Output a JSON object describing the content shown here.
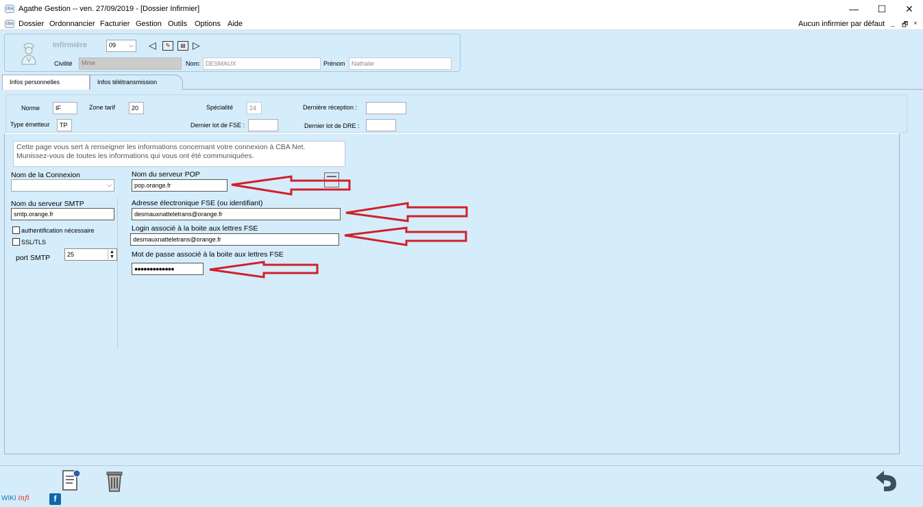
{
  "window": {
    "app_icon_label": "cba",
    "title": "Agathe Gestion   --   ven. 27/09/2019  - [Dossier Infirmier]",
    "minimize_glyph": "—",
    "maximize_glyph": "☐",
    "close_glyph": "✕"
  },
  "menu": {
    "items": [
      {
        "label": "Dossier"
      },
      {
        "label": "Ordonnancier"
      },
      {
        "label": "Facturier"
      },
      {
        "label": "Gestion"
      },
      {
        "label": "Outils"
      },
      {
        "label": "Options"
      },
      {
        "label": "Aide"
      }
    ],
    "right_status": "Aucun infirmier par défaut",
    "mdi_min": "_",
    "mdi_restore": "🗗",
    "mdi_close": "×"
  },
  "header": {
    "infirmiere_label": "Infirmière",
    "selector_value": "09",
    "prev_glyph": "◁",
    "next_glyph": "▷",
    "civilite_label": "Civilité",
    "civilite_value": "Mme",
    "nom_label": "Nom:",
    "nom_value": "DESMAUX",
    "prenom_label": "Prénom",
    "prenom_value": "Nathalie"
  },
  "tabs": [
    {
      "label": "Infos personnelles",
      "active": false
    },
    {
      "label": "Infos télétransmission",
      "active": true
    }
  ],
  "info": {
    "norme_label": "Norme",
    "norme_value": "IF",
    "zone_label": "Zone tarif",
    "zone_value": "20",
    "specialite_label": "Spécialité",
    "specialite_value": "24",
    "derniere_reception_label": "Dernière réception :",
    "derniere_reception_value": "",
    "type_emetteur_label": "Type émetteur",
    "type_emetteur_value": "TP",
    "dernier_fse_label": "Dernier lot de FSE :",
    "dernier_fse_value": "",
    "dernier_dre_label": "Dernier lot de DRE :",
    "dernier_dre_value": ""
  },
  "content": {
    "note_line1": "Cette page vous sert à renseigner les informations concernant votre connexion à CBA Net.",
    "note_line2": "Munissez-vous de toutes les informations qui vous ont été communiquées.",
    "connexion_label": "Nom de la Connexion",
    "connexion_value": "",
    "pop_label": "Nom du serveur POP",
    "pop_value": "pop.orange.fr",
    "smtp_label": "Nom du serveur SMTP",
    "smtp_value": "smtp.orange.fr",
    "email_label": "Adresse électronique FSE (ou identifiant)",
    "email_value": "desmauxnatteletrans@orange.fr",
    "auth_label": "authentification nécessaire",
    "auth_checked": false,
    "ssl_label": "SSL/TLS",
    "ssl_checked": false,
    "login_label": "Login associé à la boite aux lettres FSE",
    "login_value": "desmauxnatteletrans@orange.fr",
    "port_label": "port SMTP",
    "port_value": "25",
    "password_label": "Mot de passe associé à la boite aux lettres FSE",
    "password_value": "●●●●●●●●●●●●●"
  },
  "annotation_color": "#d0202a",
  "bottom": {
    "wiki_label": "WIKI",
    "wiki_suffix": "infi",
    "fb_label": "f",
    "back_glyph": "⮌"
  }
}
